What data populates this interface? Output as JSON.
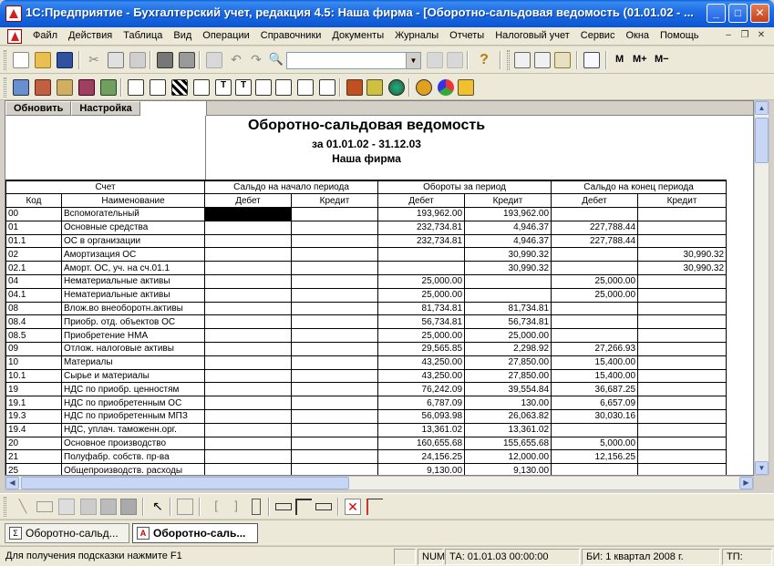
{
  "window": {
    "title": "1С:Предприятие - Бухгалтерский учет, редакция 4.5: Наша фирма - [Оборотно-сальдовая ведомость (01.01.02 - ..."
  },
  "menu": [
    "Файл",
    "Действия",
    "Таблица",
    "Вид",
    "Операции",
    "Справочники",
    "Документы",
    "Журналы",
    "Отчеты",
    "Налоговый учет",
    "Сервис",
    "Окна",
    "Помощь"
  ],
  "toolbar": {
    "m_label": "M",
    "mplus_label": "M+",
    "mminus_label": "M−",
    "search_value": ""
  },
  "report": {
    "refresh_label": "Обновить",
    "settings_label": "Настройка",
    "title": "Оборотно-сальдовая ведомость",
    "period": "за 01.01.02 - 31.12.03",
    "org": "Наша фирма",
    "head1": {
      "account": "Счет",
      "open": "Сальдо на начало периода",
      "turn": "Обороты за период",
      "close": "Сальдо на конец периода"
    },
    "head2": {
      "code": "Код",
      "name": "Наименование",
      "debit": "Дебет",
      "credit": "Кредит"
    },
    "rows": [
      {
        "code": "00",
        "name": "Вспомогательный",
        "od": "",
        "oc": "",
        "td": "193,962.00",
        "tc": "193,962.00",
        "cd": "",
        "cc": ""
      },
      {
        "code": "01",
        "name": "Основные средства",
        "od": "",
        "oc": "",
        "td": "232,734.81",
        "tc": "4,946.37",
        "cd": "227,788.44",
        "cc": ""
      },
      {
        "code": "01.1",
        "name": "ОС в организации",
        "od": "",
        "oc": "",
        "td": "232,734.81",
        "tc": "4,946.37",
        "cd": "227,788.44",
        "cc": ""
      },
      {
        "code": "02",
        "name": "Амортизация ОС",
        "od": "",
        "oc": "",
        "td": "",
        "tc": "30,990.32",
        "cd": "",
        "cc": "30,990.32"
      },
      {
        "code": "02.1",
        "name": "Аморт. ОС, уч. на сч.01.1",
        "od": "",
        "oc": "",
        "td": "",
        "tc": "30,990.32",
        "cd": "",
        "cc": "30,990.32"
      },
      {
        "code": "04",
        "name": "Нематериальные активы",
        "od": "",
        "oc": "",
        "td": "25,000.00",
        "tc": "",
        "cd": "25,000.00",
        "cc": ""
      },
      {
        "code": "04.1",
        "name": "Нематериальные активы",
        "od": "",
        "oc": "",
        "td": "25,000.00",
        "tc": "",
        "cd": "25,000.00",
        "cc": ""
      },
      {
        "code": "08",
        "name": "Влож.во внеоборотн.активы",
        "od": "",
        "oc": "",
        "td": "81,734.81",
        "tc": "81,734.81",
        "cd": "",
        "cc": ""
      },
      {
        "code": "08.4",
        "name": "Приобр. отд. объектов ОС",
        "od": "",
        "oc": "",
        "td": "56,734.81",
        "tc": "56,734.81",
        "cd": "",
        "cc": ""
      },
      {
        "code": "08.5",
        "name": "Приобретение НМА",
        "od": "",
        "oc": "",
        "td": "25,000.00",
        "tc": "25,000.00",
        "cd": "",
        "cc": ""
      },
      {
        "code": "09",
        "name": "Отлож. налоговые активы",
        "od": "",
        "oc": "",
        "td": "29,565.85",
        "tc": "2,298.92",
        "cd": "27,266.93",
        "cc": ""
      },
      {
        "code": "10",
        "name": "Материалы",
        "od": "",
        "oc": "",
        "td": "43,250.00",
        "tc": "27,850.00",
        "cd": "15,400.00",
        "cc": ""
      },
      {
        "code": "10.1",
        "name": "Сырье и материалы",
        "od": "",
        "oc": "",
        "td": "43,250.00",
        "tc": "27,850.00",
        "cd": "15,400.00",
        "cc": ""
      },
      {
        "code": "19",
        "name": "НДС по приобр. ценностям",
        "od": "",
        "oc": "",
        "td": "76,242.09",
        "tc": "39,554.84",
        "cd": "36,687.25",
        "cc": ""
      },
      {
        "code": "19.1",
        "name": "НДС по приобретенным ОС",
        "od": "",
        "oc": "",
        "td": "6,787.09",
        "tc": "130.00",
        "cd": "6,657.09",
        "cc": ""
      },
      {
        "code": "19.3",
        "name": "НДС по приобретенным МПЗ",
        "od": "",
        "oc": "",
        "td": "56,093.98",
        "tc": "26,063.82",
        "cd": "30,030.16",
        "cc": ""
      },
      {
        "code": "19.4",
        "name": "НДС, уплач. таможенн.орг.",
        "od": "",
        "oc": "",
        "td": "13,361.02",
        "tc": "13,361.02",
        "cd": "",
        "cc": ""
      },
      {
        "code": "20",
        "name": "Основное производство",
        "od": "",
        "oc": "",
        "td": "160,655.68",
        "tc": "155,655.68",
        "cd": "5,000.00",
        "cc": ""
      },
      {
        "code": "21",
        "name": "Полуфабр. собств. пр-ва",
        "od": "",
        "oc": "",
        "td": "24,156.25",
        "tc": "12,000.00",
        "cd": "12,156.25",
        "cc": ""
      },
      {
        "code": "25",
        "name": "Общепроизводств. расходы",
        "od": "",
        "oc": "",
        "td": "9,130.00",
        "tc": "9,130.00",
        "cd": "",
        "cc": ""
      }
    ]
  },
  "window_tabs": [
    {
      "label": "Оборотно-сальд...",
      "active": false
    },
    {
      "label": "Оборотно-саль...",
      "active": true
    }
  ],
  "status": {
    "hint": "Для получения подсказки нажмите F1",
    "num": "NUM",
    "ta": "ТА: 01.01.03  00:00:00",
    "bi": "БИ: 1 квартал 2008 г.",
    "tp": "ТП:"
  }
}
